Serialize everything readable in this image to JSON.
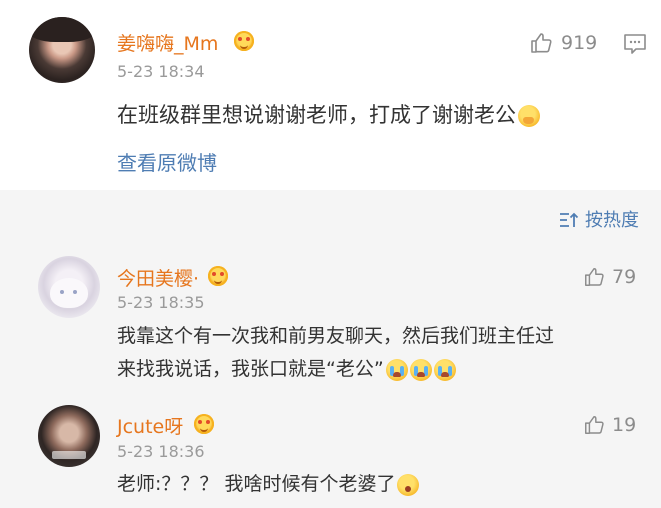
{
  "main_comment": {
    "username": "姜嗨嗨_Mm",
    "time": "5-23 18:34",
    "likes": "919",
    "text": "在班级群里想说谢谢老师，打成了谢谢老公",
    "view_original": "查看原微博"
  },
  "sort": {
    "label": "按热度"
  },
  "replies": [
    {
      "username": "今田美樱·",
      "time": "5-23 18:35",
      "likes": "79",
      "line1": "我靠这个有一次我和前男友聊天，然后我们班主任过",
      "line2": "来找我说话，我张口就是“老公”"
    },
    {
      "username": "Jcute呀",
      "time": "5-23 18:36",
      "likes": "19",
      "text": "老师:？？？ 我啥时候有个老婆了"
    }
  ],
  "icons": {
    "like": "thumbs-up-icon",
    "comment": "comment-icon",
    "sort": "sort-icon",
    "vip": "vip-badge-icon"
  },
  "colors": {
    "username": "#e6761e",
    "link": "#4f7db3",
    "panel_bg": "#f5f5f5"
  }
}
